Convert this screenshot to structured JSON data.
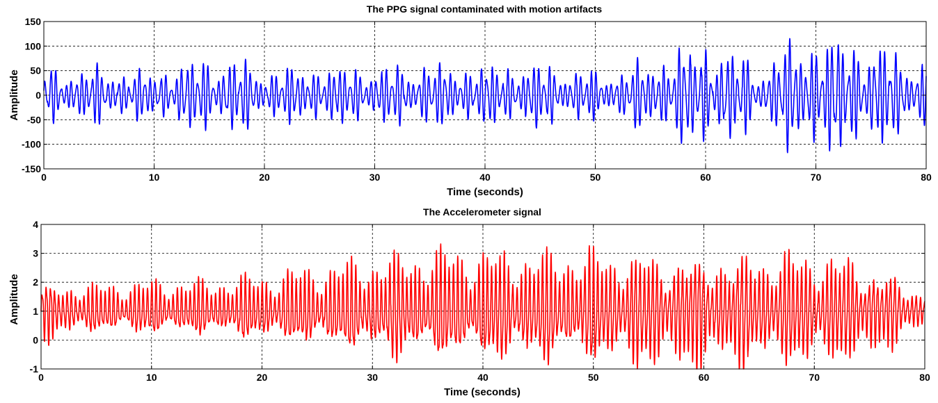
{
  "chart_data": [
    {
      "type": "line",
      "title": "The PPG signal contaminated with motion artifacts",
      "xlabel": "Time (seconds)",
      "ylabel": "Amplitude",
      "xlim": [
        0,
        80
      ],
      "ylim": [
        -150,
        150
      ],
      "xticks": [
        0,
        10,
        20,
        30,
        40,
        50,
        60,
        70,
        80
      ],
      "yticks": [
        150,
        100,
        50,
        0,
        -50,
        -100,
        -150
      ],
      "grid": true,
      "series": [
        {
          "color": "#0000ff",
          "dominant_frequency_hz": 2.1,
          "envelope": {
            "t": [
              0,
              5,
              10,
              13,
              17.5,
              20,
              25,
              30,
              35,
              40,
              45,
              50,
              52,
              55,
              60,
              63,
              65,
              67,
              69,
              72,
              75,
              78,
              80
            ],
            "amplitude": [
              60,
              62,
              55,
              80,
              85,
              58,
              70,
              65,
              72,
              70,
              75,
              52,
              58,
              85,
              125,
              95,
              60,
              110,
              140,
              130,
              120,
              95,
              70
            ]
          }
        }
      ]
    },
    {
      "type": "line",
      "title": "The Accelerometer signal",
      "xlabel": "Time (seconds)",
      "ylabel": "Amplitude",
      "xlim": [
        0,
        80
      ],
      "ylim": [
        -1,
        4
      ],
      "xticks": [
        0,
        10,
        20,
        30,
        40,
        50,
        60,
        70,
        80
      ],
      "yticks": [
        4,
        3,
        2,
        1,
        0,
        -1
      ],
      "grid": true,
      "series": [
        {
          "color": "#ff0000",
          "dominant_frequency_hz": 2.6,
          "baseline": 1.0,
          "envelope": {
            "t": [
              0,
              5,
              10,
              15,
              20,
              25,
              30,
              35,
              40,
              45,
              50,
              55,
              60,
              65,
              70,
              75,
              77,
              78,
              80
            ],
            "amplitude": [
              1.5,
              1.3,
              1.5,
              1.5,
              1.8,
              2.2,
              2.6,
              3.0,
              3.0,
              2.9,
              3.0,
              3.0,
              2.9,
              2.9,
              3.0,
              2.5,
              2.0,
              1.2,
              1.2
            ]
          }
        }
      ]
    }
  ]
}
